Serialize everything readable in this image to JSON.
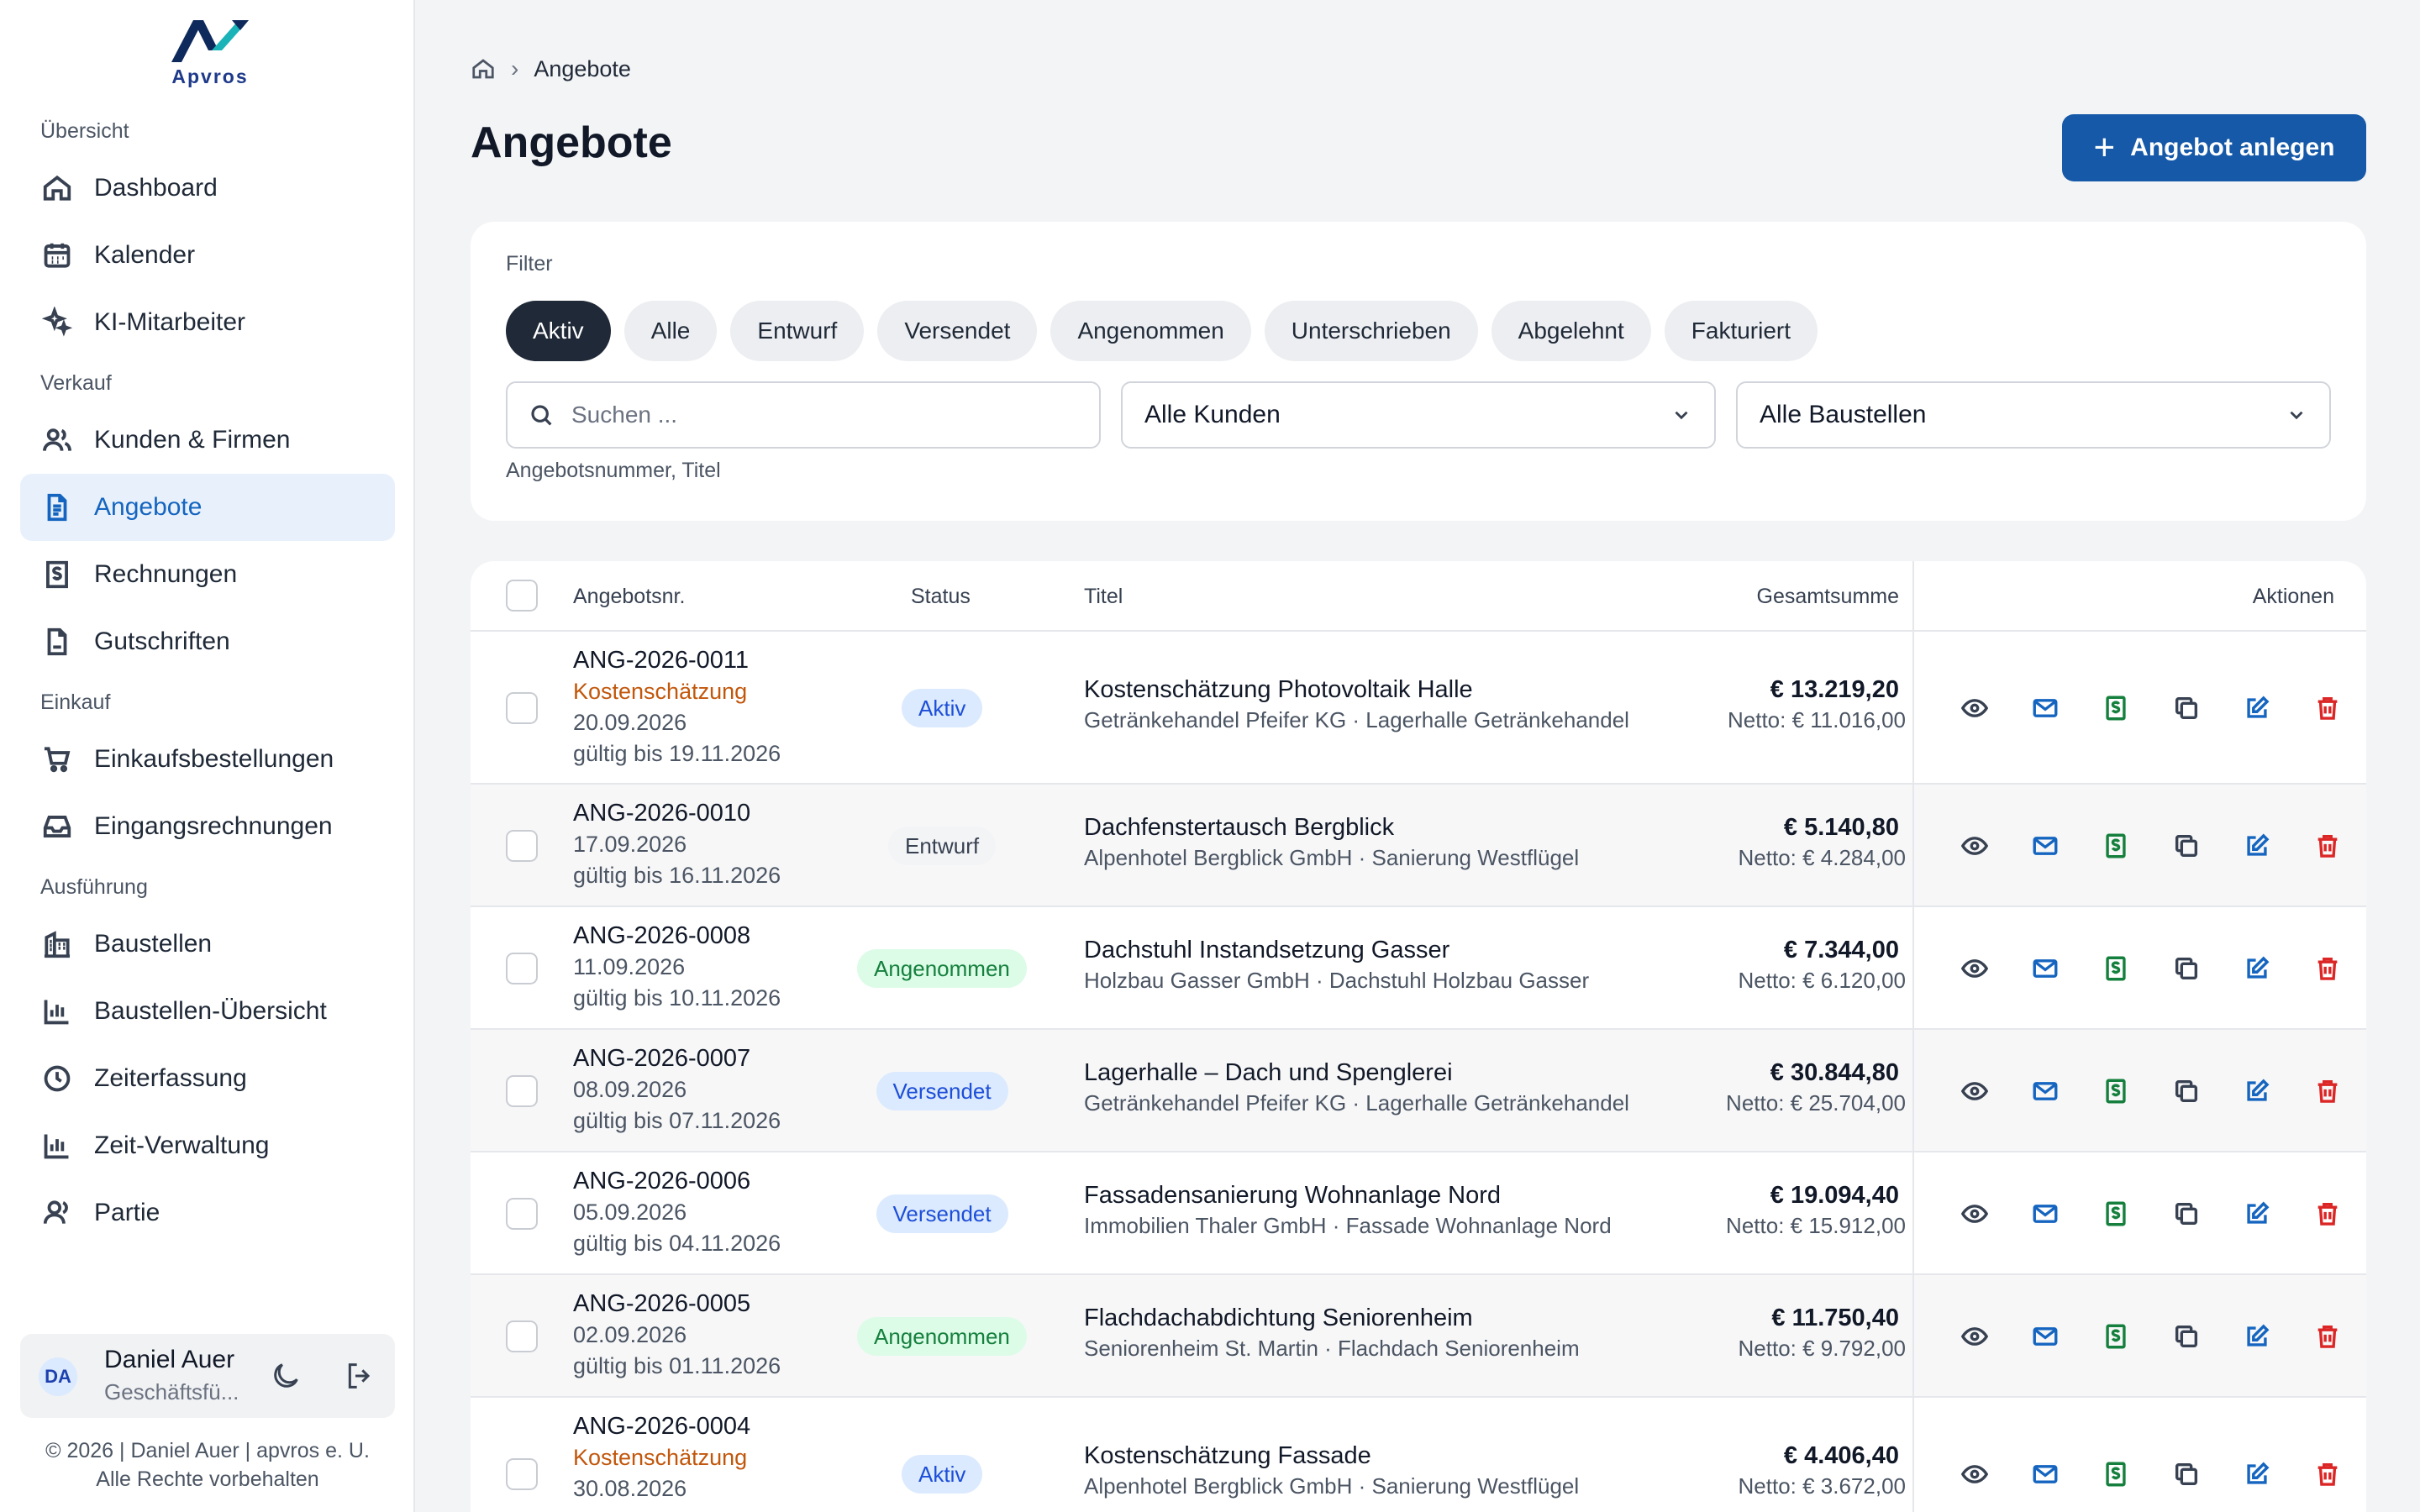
{
  "brand": {
    "name": "Apvros"
  },
  "sidebar": {
    "sections": [
      {
        "label": "Übersicht",
        "items": [
          {
            "label": "Dashboard",
            "icon": "home-icon"
          },
          {
            "label": "Kalender",
            "icon": "calendar-icon"
          },
          {
            "label": "KI-Mitarbeiter",
            "icon": "sparkles-icon"
          }
        ]
      },
      {
        "label": "Verkauf",
        "items": [
          {
            "label": "Kunden & Firmen",
            "icon": "users-icon"
          },
          {
            "label": "Angebote",
            "icon": "document-icon",
            "active": true
          },
          {
            "label": "Rechnungen",
            "icon": "invoice-dollar-icon"
          },
          {
            "label": "Gutschriften",
            "icon": "file-icon"
          }
        ]
      },
      {
        "label": "Einkauf",
        "items": [
          {
            "label": "Einkaufsbestellungen",
            "icon": "cart-icon"
          },
          {
            "label": "Eingangsrechnungen",
            "icon": "inbox-icon"
          }
        ]
      },
      {
        "label": "Ausführung",
        "items": [
          {
            "label": "Baustellen",
            "icon": "building-icon"
          },
          {
            "label": "Baustellen-Übersicht",
            "icon": "bar-chart-icon"
          },
          {
            "label": "Zeiterfassung",
            "icon": "clock-icon"
          },
          {
            "label": "Zeit-Verwaltung",
            "icon": "bar-chart-icon"
          },
          {
            "label": "Partie",
            "icon": "team-icon"
          }
        ]
      }
    ],
    "user": {
      "initials": "DA",
      "name": "Daniel Auer",
      "role": "Geschäftsfü..."
    },
    "copyright_line1": "© 2026 | Daniel Auer | apvros e. U.",
    "copyright_line2": "Alle Rechte vorbehalten"
  },
  "header": {
    "breadcrumb_current": "Angebote",
    "title": "Angebote",
    "add_button": "Angebot anlegen"
  },
  "filter": {
    "label": "Filter",
    "chips": [
      "Aktiv",
      "Alle",
      "Entwurf",
      "Versendet",
      "Angenommen",
      "Unterschrieben",
      "Abgelehnt",
      "Fakturiert"
    ],
    "active_chip": "Aktiv",
    "search_placeholder": "Suchen ...",
    "customer_select": "Alle Kunden",
    "site_select": "Alle Baustellen",
    "hint": "Angebotsnummer, Titel"
  },
  "table": {
    "columns": {
      "number": "Angebotsnr.",
      "status": "Status",
      "title": "Titel",
      "total": "Gesamtsumme",
      "actions": "Aktionen"
    },
    "rows": [
      {
        "number": "ANG-2026-0011",
        "type": "Kostenschätzung",
        "date": "20.09.2026",
        "valid": "gültig bis 19.11.2026",
        "status": "Aktiv",
        "status_kind": "aktiv",
        "title": "Kostenschätzung Photovoltaik Halle",
        "subtitle": "Getränkehandel Pfeifer KG · Lagerhalle Getränkehandel",
        "total": "€ 13.219,20",
        "net": "Netto: € 11.016,00"
      },
      {
        "number": "ANG-2026-0010",
        "type": "",
        "date": "17.09.2026",
        "valid": "gültig bis 16.11.2026",
        "status": "Entwurf",
        "status_kind": "entwurf",
        "title": "Dachfenstertausch Bergblick",
        "subtitle": "Alpenhotel Bergblick GmbH · Sanierung Westflügel",
        "total": "€ 5.140,80",
        "net": "Netto: € 4.284,00"
      },
      {
        "number": "ANG-2026-0008",
        "type": "",
        "date": "11.09.2026",
        "valid": "gültig bis 10.11.2026",
        "status": "Angenommen",
        "status_kind": "angen",
        "title": "Dachstuhl Instandsetzung Gasser",
        "subtitle": "Holzbau Gasser GmbH · Dachstuhl Holzbau Gasser",
        "total": "€ 7.344,00",
        "net": "Netto: € 6.120,00"
      },
      {
        "number": "ANG-2026-0007",
        "type": "",
        "date": "08.09.2026",
        "valid": "gültig bis 07.11.2026",
        "status": "Versendet",
        "status_kind": "versendet",
        "title": "Lagerhalle – Dach und Spenglerei",
        "subtitle": "Getränkehandel Pfeifer KG · Lagerhalle Getränkehandel",
        "total": "€ 30.844,80",
        "net": "Netto: € 25.704,00"
      },
      {
        "number": "ANG-2026-0006",
        "type": "",
        "date": "05.09.2026",
        "valid": "gültig bis 04.11.2026",
        "status": "Versendet",
        "status_kind": "versendet",
        "title": "Fassadensanierung Wohnanlage Nord",
        "subtitle": "Immobilien Thaler GmbH · Fassade Wohnanlage Nord",
        "total": "€ 19.094,40",
        "net": "Netto: € 15.912,00"
      },
      {
        "number": "ANG-2026-0005",
        "type": "",
        "date": "02.09.2026",
        "valid": "gültig bis 01.11.2026",
        "status": "Angenommen",
        "status_kind": "angen",
        "title": "Flachdachabdichtung Seniorenheim",
        "subtitle": "Seniorenheim St. Martin · Flachdach Seniorenheim",
        "total": "€ 11.750,40",
        "net": "Netto: € 9.792,00"
      },
      {
        "number": "ANG-2026-0004",
        "type": "Kostenschätzung",
        "date": "30.08.2026",
        "valid": "",
        "status": "Aktiv",
        "status_kind": "aktiv",
        "title": "Kostenschätzung Fassade",
        "subtitle": "Alpenhotel Bergblick GmbH · Sanierung Westflügel",
        "total": "€ 4.406,40",
        "net": "Netto: € 3.672,00"
      }
    ]
  },
  "colors": {
    "primary": "#1559a8",
    "active_nav_bg": "#e8f1fb",
    "action_blue": "#1565c0",
    "action_green": "#15803d",
    "action_red": "#dc2626",
    "orange_type": "#c2570c"
  }
}
